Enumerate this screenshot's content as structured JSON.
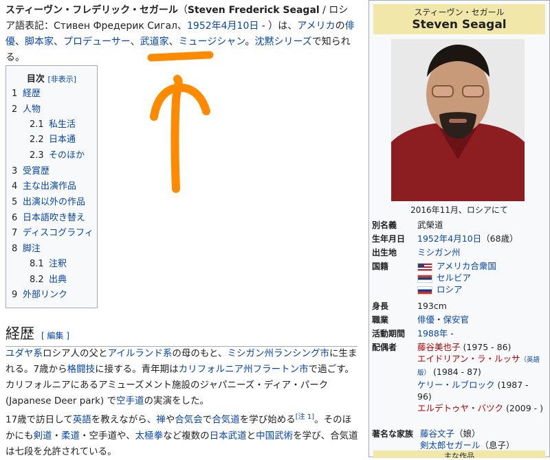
{
  "intro": {
    "name_ja": "スティーヴン・フレデリック・セガール",
    "name_en": "Steven Frederick Seagal",
    "after_en": " / ロシア語表記：",
    "russian": "Стивен Фредерик Сигал",
    "sep": " - ",
    "birth_link": "1952年4月10日",
    "after_birth": " - ）は、",
    "link_america": "アメリカ",
    "no": "の",
    "link_actor": "俳優",
    "c1": "、",
    "link_writer": "脚本家",
    "c2": "、",
    "link_producer": "プロデューサー",
    "c3": "、",
    "link_budoka": "武道家",
    "c4": "、",
    "link_musician": "ミュージシャン",
    "c5": "。",
    "link_chinmoku": "沈黙シリーズ",
    "tail": "で知られる。"
  },
  "toc": {
    "title": "目次",
    "hide_label": "[非表示]",
    "items": [
      {
        "num": "1",
        "label": "経歴"
      },
      {
        "num": "2",
        "label": "人物"
      },
      {
        "num": "2.1",
        "label": "私生活"
      },
      {
        "num": "2.2",
        "label": "日本通"
      },
      {
        "num": "2.3",
        "label": "そのほか"
      },
      {
        "num": "3",
        "label": "受賞歴"
      },
      {
        "num": "4",
        "label": "主な出演作品"
      },
      {
        "num": "5",
        "label": "出演以外の作品"
      },
      {
        "num": "6",
        "label": "日本語吹き替え"
      },
      {
        "num": "7",
        "label": "ディスコグラフィ"
      },
      {
        "num": "8",
        "label": "脚注"
      },
      {
        "num": "8.1",
        "label": "注釈"
      },
      {
        "num": "8.2",
        "label": "出典"
      },
      {
        "num": "9",
        "label": "外部リンク"
      }
    ]
  },
  "section": {
    "heading": "経歴",
    "edit_label": "[ 編集 ]"
  },
  "para1": {
    "l_yudaya": "ユダヤ系",
    "t1": "ロシア人の父と",
    "l_ireland": "アイルランド系",
    "t2": "の母のもと、",
    "l_michigan": "ミシガン州ランシング市",
    "t3": "に生まれる。7歳から",
    "l_kakutou": "格闘技",
    "t4": "に接する。青年期は",
    "l_fullerton": "カリフォルニア州フラートン市",
    "t5": "で過ごす。カリフォルニアにあるアミューズメント施設のジャパニーズ・ディア・パーク (Japanese Deer park) で",
    "l_karate": "空手道",
    "t6": "の実演をした。"
  },
  "para2": {
    "t1": "17歳で訪日して",
    "l_eigo": "英語",
    "t2": "を教えながら、",
    "l_zen": "禅",
    "t3": "や",
    "l_gasshukai": "合気会",
    "t4": "で",
    "l_aikido": "合気道",
    "t5": "を学び始める",
    "note": "[注 1]",
    "t6": "。そのほかにも",
    "l_kendo": "剣道",
    "t7": "・",
    "l_judo": "柔道",
    "t8": "・空手道や、",
    "l_taikyoku": "太極拳",
    "t9": "など複数の",
    "l_nihonbudo": "日本武道",
    "t10": "と",
    "l_chugoku": "中国武術",
    "t11": "を学び、合気道は七段を允許されている。"
  },
  "infobox": {
    "name_ja": "スティーヴン・セガール",
    "name_en": "Steven Seagal",
    "caption": "2016年11月、ロシアにて",
    "rows": {
      "betsumei": {
        "label": "別名義",
        "value": "武榮道"
      },
      "birth": {
        "label": "生年月日",
        "date": "1952年4月10日",
        "age": "（68歳）"
      },
      "birthplace": {
        "label": "出生地",
        "value": "ミシガン州"
      },
      "nationality": {
        "label": "国籍",
        "c1": "アメリカ合衆国",
        "c2": "セルビア",
        "c3": "ロシア"
      },
      "height": {
        "label": "身長",
        "value": "193cm"
      },
      "job": {
        "label": "職業",
        "v1": "俳優",
        "sep": "・",
        "v2": "保安官"
      },
      "active": {
        "label": "活動期間",
        "v1": "1988年",
        "v2": " -"
      },
      "spouse": {
        "label": "配偶者",
        "s1": "藤谷美也子",
        "s1y": " (1975 - 86)",
        "s2": "エイドリアン・ラ・ルッサ",
        "s2tag": "（英語版）",
        "s2y": " (1984 - 87)",
        "s3": "ケリー・ルブロック",
        "s3y": " (1987 - 96)",
        "s4": "エルデトゥヤ・バツク",
        "s4y": " (2009 - )"
      },
      "family": {
        "label": "著名な家族",
        "f1": "藤谷文子",
        "f1r": "（娘）",
        "f2": "剣太郎セガール",
        "f2r": "（息子）"
      }
    },
    "footer": "主な作品"
  },
  "colors": {
    "link": "#0645ad",
    "redlink": "#ba0000",
    "annotation": "#ff8a00",
    "header_bg": "#f0e7a8"
  }
}
